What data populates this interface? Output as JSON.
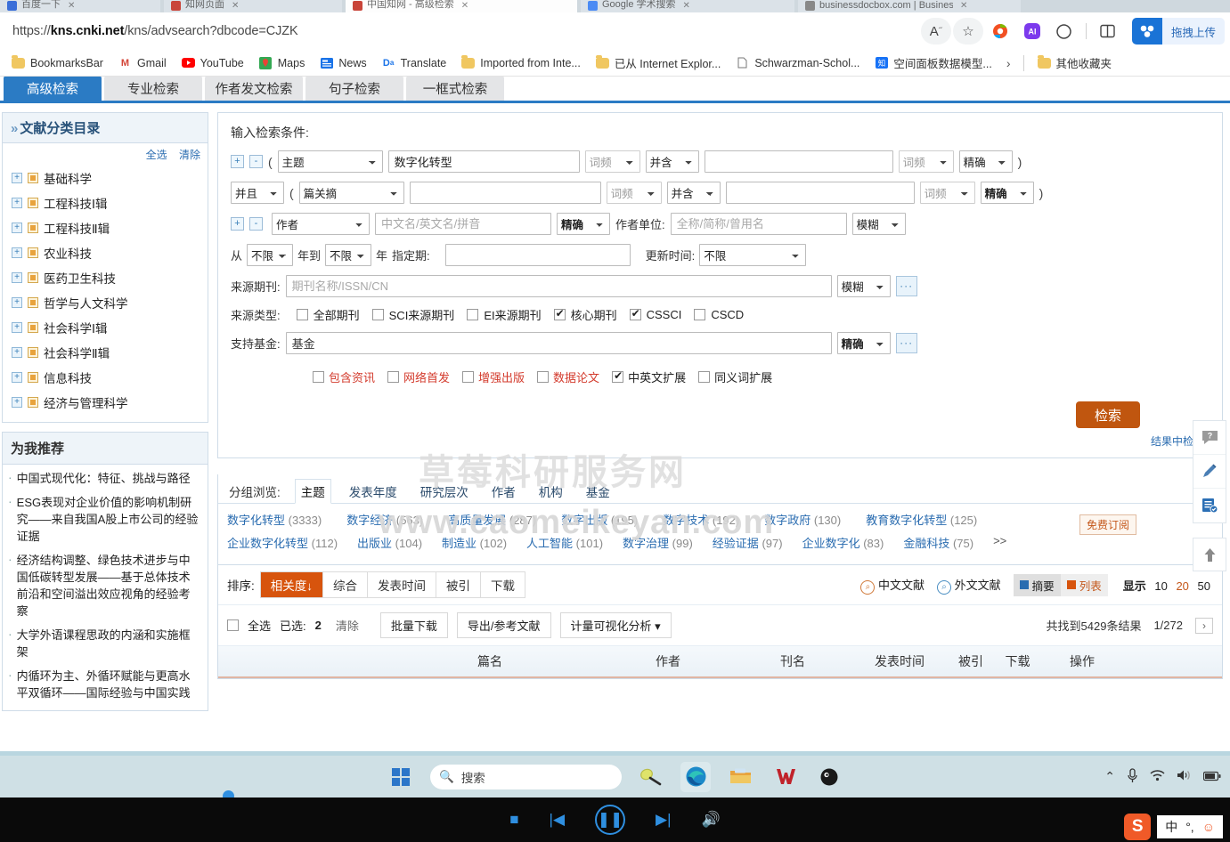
{
  "browser": {
    "tabs": [
      {
        "label": "百度一下",
        "active": false
      },
      {
        "label": "知网页面",
        "active": false
      },
      {
        "label": "中国知网 - 高级检索",
        "active": true
      },
      {
        "label": "Google 学术搜索",
        "active": false
      },
      {
        "label": "businessdocbox.com | Business, Fin...",
        "active": false
      }
    ],
    "url_prefix": "https://",
    "url_host": "kns.cnki.net",
    "url_path": "/kns/advsearch?dbcode=CJZK",
    "toolbar_icons": [
      "read-aloud-icon",
      "favorite-star-icon",
      "browser-essentials-icon",
      "copilot-icon",
      "split-screen-icon",
      "collections-icon"
    ],
    "upload_button": "拖拽上传",
    "bookmarks": [
      {
        "label": "BookmarksBar",
        "icon": "folder-icon"
      },
      {
        "label": "Gmail",
        "icon": "gmail-icon"
      },
      {
        "label": "YouTube",
        "icon": "youtube-icon"
      },
      {
        "label": "Maps",
        "icon": "maps-icon"
      },
      {
        "label": "News",
        "icon": "news-icon"
      },
      {
        "label": "Translate",
        "icon": "translate-icon"
      },
      {
        "label": "Imported from Inte...",
        "icon": "folder-icon"
      },
      {
        "label": "已从 Internet Explor...",
        "icon": "folder-icon"
      },
      {
        "label": "Schwarzman-Schol...",
        "icon": "page-icon"
      },
      {
        "label": "空间面板数据模型...",
        "icon": "zhihu-icon"
      }
    ],
    "bookmarks_overflow": "›",
    "bookmarks_other": "其他收藏夹"
  },
  "site": {
    "tabs": [
      {
        "label": "高级检索",
        "active": true
      },
      {
        "label": "专业检索",
        "active": false
      },
      {
        "label": "作者发文检索",
        "active": false
      },
      {
        "label": "句子检索",
        "active": false
      },
      {
        "label": "一框式检索",
        "active": false
      }
    ]
  },
  "sidebar": {
    "catalog_title": "文献分类目录",
    "select_all": "全选",
    "clear": "清除",
    "categories": [
      "基础科学",
      "工程科技Ⅰ辑",
      "工程科技Ⅱ辑",
      "农业科技",
      "医药卫生科技",
      "哲学与人文科学",
      "社会科学Ⅰ辑",
      "社会科学Ⅱ辑",
      "信息科技",
      "经济与管理科学"
    ],
    "recommend_title": "为我推荐",
    "recommendations": [
      "中国式现代化：特征、挑战与路径",
      "ESG表现对企业价值的影响机制研究——来自我国A股上市公司的经验证据",
      "经济结构调整、绿色技术进步与中国低碳转型发展——基于总体技术前沿和空间溢出效应视角的经验考察",
      "大学外语课程思政的内涵和实施框架",
      "内循环为主、外循环赋能与更高水平双循环——国际经验与中国实践"
    ]
  },
  "search_form": {
    "heading": "输入检索条件:",
    "row1": {
      "plus": "+",
      "minus": "-",
      "open_paren": "(",
      "close_paren": ")",
      "field": "主题",
      "value": "数字化转型",
      "freq1": "词频",
      "logic": "并含",
      "value2": "",
      "freq2": "词频",
      "match": "精确"
    },
    "row2": {
      "bool": "并且",
      "open_paren": "(",
      "close_paren": ")",
      "field": "篇关摘",
      "value": "",
      "freq1": "词频",
      "logic": "并含",
      "value2": "",
      "freq2": "词频",
      "match": "精确"
    },
    "row3": {
      "plus": "+",
      "minus": "-",
      "field": "作者",
      "placeholder": "中文名/英文名/拼音",
      "match": "精确",
      "affiliation_label": "作者单位:",
      "affiliation_placeholder": "全称/简称/曾用名",
      "affiliation_match": "模糊"
    },
    "date_row": {
      "from": "从",
      "from_value": "不限",
      "year1": "年到",
      "to_value": "不限",
      "year2": "年",
      "specific_label": "指定期:",
      "specific_value": "",
      "update_label": "更新时间:",
      "update_value": "不限"
    },
    "journal_row": {
      "label": "来源期刊:",
      "placeholder": "期刊名称/ISSN/CN",
      "match": "模糊",
      "more": "···"
    },
    "source_type": {
      "label": "来源类型:",
      "options": [
        {
          "label": "全部期刊",
          "checked": false
        },
        {
          "label": "SCI来源期刊",
          "checked": false
        },
        {
          "label": "EI来源期刊",
          "checked": false
        },
        {
          "label": "核心期刊",
          "checked": true
        },
        {
          "label": "CSSCI",
          "checked": true
        },
        {
          "label": "CSCD",
          "checked": false
        }
      ]
    },
    "fund_row": {
      "label": "支持基金:",
      "value": "基金",
      "match": "精确",
      "more": "···"
    },
    "extra_options": [
      {
        "label": "包含资讯",
        "checked": false,
        "red": true
      },
      {
        "label": "网络首发",
        "checked": false,
        "red": true
      },
      {
        "label": "增强出版",
        "checked": false,
        "red": true
      },
      {
        "label": "数据论文",
        "checked": false,
        "red": true
      },
      {
        "label": "中英文扩展",
        "checked": true,
        "red": false
      },
      {
        "label": "同义词扩展",
        "checked": false,
        "red": false
      }
    ],
    "submit": "检索",
    "search_in_results": "结果中检索",
    "subscribe": "免费订阅"
  },
  "watermark": {
    "line1": "草莓科研服务网",
    "line2": "www.caomeikeyan.com"
  },
  "grouping": {
    "label": "分组浏览:",
    "tabs": [
      {
        "label": "主题",
        "active": true
      },
      {
        "label": "发表年度",
        "active": false
      },
      {
        "label": "研究层次",
        "active": false
      },
      {
        "label": "作者",
        "active": false
      },
      {
        "label": "机构",
        "active": false
      },
      {
        "label": "基金",
        "active": false
      }
    ],
    "tags_row1": [
      {
        "name": "数字化转型",
        "count": "(3333)"
      },
      {
        "name": "数字经济",
        "count": "(563)"
      },
      {
        "name": "高质量发展",
        "count": "(287)"
      },
      {
        "name": "数字出版",
        "count": "(195)"
      },
      {
        "name": "数字技术",
        "count": "(192)"
      },
      {
        "name": "数字政府",
        "count": "(130)"
      },
      {
        "name": "教育数字化转型",
        "count": "(125)"
      }
    ],
    "tags_row2": [
      {
        "name": "企业数字化转型",
        "count": "(112)"
      },
      {
        "name": "出版业",
        "count": "(104)"
      },
      {
        "name": "制造业",
        "count": "(102)"
      },
      {
        "name": "人工智能",
        "count": "(101)"
      },
      {
        "name": "数字治理",
        "count": "(99)"
      },
      {
        "name": "经验证据",
        "count": "(97)"
      },
      {
        "name": "企业数字化",
        "count": "(83)"
      },
      {
        "name": "金融科技",
        "count": "(75)"
      },
      {
        "name": ">>",
        "count": ""
      }
    ],
    "close": "×"
  },
  "results": {
    "sort_label": "排序:",
    "sort_options": [
      {
        "label": "相关度",
        "active": true,
        "arrow": "↓"
      },
      {
        "label": "综合",
        "active": false,
        "arrow": ""
      },
      {
        "label": "发表时间",
        "active": false,
        "arrow": ""
      },
      {
        "label": "被引",
        "active": false,
        "arrow": ""
      },
      {
        "label": "下载",
        "active": false,
        "arrow": ""
      }
    ],
    "chinese_lit": "中文文献",
    "foreign_lit": "外文文献",
    "view_abstract": "摘要",
    "view_list": "列表",
    "show_label": "显示",
    "show_counts": [
      "10",
      "20",
      "50"
    ],
    "show_active": "20",
    "select_all": "全选",
    "selected_label": "已选:",
    "selected_count": "2",
    "clear": "清除",
    "batch_download": "批量下载",
    "export": "导出/参考文献",
    "analysis": "计量可视化分析",
    "total_text": "共找到5429条结果",
    "page_current": "1/272",
    "next_page": "›",
    "columns": [
      "篇名",
      "作者",
      "刊名",
      "发表时间",
      "被引",
      "下载",
      "操作"
    ]
  },
  "floatbar": {
    "items": [
      "feedback-icon",
      "edit-icon",
      "note-icon"
    ],
    "scroll_top": "scroll-top-icon"
  },
  "taskbar": {
    "start": "start-icon",
    "search_placeholder": "搜索",
    "apps": [
      "tennis-icon",
      "edge-icon",
      "file-explorer-icon",
      "wps-icon",
      "app-icon"
    ],
    "tray": [
      "chevron-up-icon",
      "microphone-icon",
      "wifi-icon",
      "volume-icon",
      "battery-icon"
    ]
  },
  "mediabar": {
    "controls": [
      "stop-icon",
      "previous-icon",
      "pause-icon",
      "next-icon",
      "volume-icon"
    ],
    "ime_label": "中"
  },
  "colors": {
    "accent_blue": "#2b7bc4",
    "accent_orange": "#c0560f",
    "link_blue": "#2a6cb0",
    "red": "#d33a2c"
  }
}
